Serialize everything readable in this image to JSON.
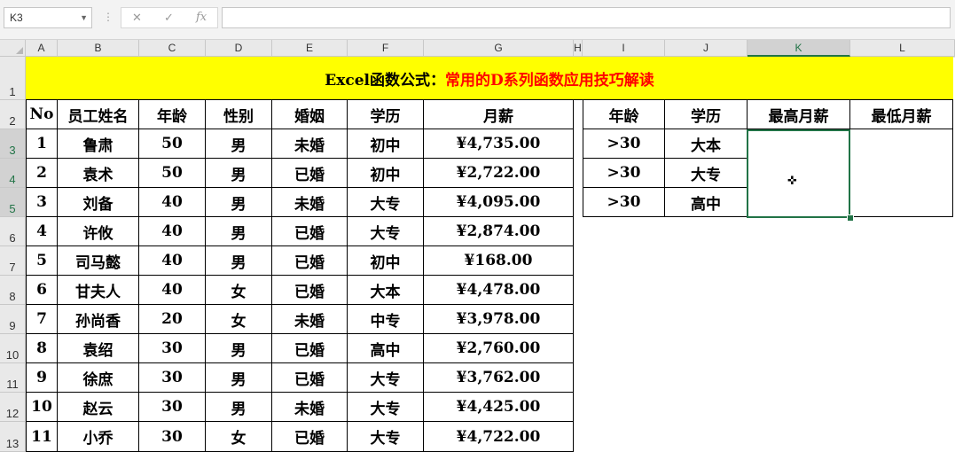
{
  "formula_bar": {
    "name_box": "K3",
    "cancel_icon": "✕",
    "enter_icon": "✓",
    "fx_label": "fx",
    "formula": ""
  },
  "columns": [
    "A",
    "B",
    "C",
    "D",
    "E",
    "F",
    "G",
    "H",
    "I",
    "J",
    "K",
    "L"
  ],
  "rows": [
    "1",
    "2",
    "3",
    "4",
    "5",
    "6",
    "7",
    "8",
    "9",
    "10",
    "11",
    "12",
    "13"
  ],
  "title": {
    "part1": "Excel函数公式：",
    "part2": "常用的D系列函数应用技巧解读"
  },
  "main_table": {
    "headers": [
      "No",
      "员工姓名",
      "年龄",
      "性别",
      "婚姻",
      "学历",
      "月薪"
    ],
    "rows": [
      [
        "1",
        "鲁肃",
        "50",
        "男",
        "未婚",
        "初中",
        "¥4,735.00"
      ],
      [
        "2",
        "袁术",
        "50",
        "男",
        "已婚",
        "初中",
        "¥2,722.00"
      ],
      [
        "3",
        "刘备",
        "40",
        "男",
        "未婚",
        "大专",
        "¥4,095.00"
      ],
      [
        "4",
        "许攸",
        "40",
        "男",
        "已婚",
        "大专",
        "¥2,874.00"
      ],
      [
        "5",
        "司马懿",
        "40",
        "男",
        "已婚",
        "初中",
        "¥168.00"
      ],
      [
        "6",
        "甘夫人",
        "40",
        "女",
        "已婚",
        "大本",
        "¥4,478.00"
      ],
      [
        "7",
        "孙尚香",
        "20",
        "女",
        "未婚",
        "中专",
        "¥3,978.00"
      ],
      [
        "8",
        "袁绍",
        "30",
        "男",
        "已婚",
        "高中",
        "¥2,760.00"
      ],
      [
        "9",
        "徐庶",
        "30",
        "男",
        "已婚",
        "大专",
        "¥3,762.00"
      ],
      [
        "10",
        "赵云",
        "30",
        "男",
        "未婚",
        "大专",
        "¥4,425.00"
      ],
      [
        "11",
        "小乔",
        "30",
        "女",
        "已婚",
        "大专",
        "¥4,722.00"
      ]
    ]
  },
  "criteria_table": {
    "headers": [
      "年龄",
      "学历",
      "最高月薪",
      "最低月薪"
    ],
    "rows": [
      [
        ">30",
        "大本"
      ],
      [
        ">30",
        "大专"
      ],
      [
        ">30",
        "高中"
      ]
    ]
  },
  "selection": {
    "cell": "K3",
    "accent_color": "#217346"
  }
}
